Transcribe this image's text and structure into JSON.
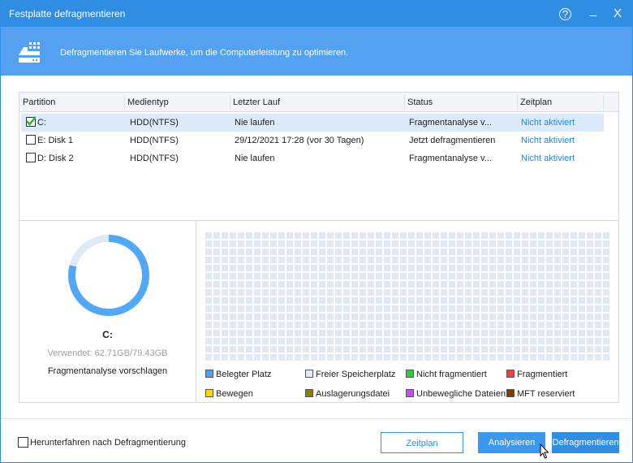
{
  "window": {
    "title": "Festplatte defragmentieren",
    "help_icon": "?",
    "minimize_icon": "_",
    "close_icon": "X"
  },
  "banner": {
    "text": "Defragmentieren Sie Laufwerke, um die Computerleistung zu optimieren."
  },
  "table": {
    "headers": [
      "Partition",
      "Medientyp",
      "Letzter Lauf",
      "Status",
      "Zeitplan"
    ],
    "rows": [
      {
        "checked": true,
        "partition": "C:",
        "media": "HDD(NTFS)",
        "last_run": "Nie laufen",
        "status": "Fragmentanalyse v...",
        "schedule": "Nicht aktiviert"
      },
      {
        "checked": false,
        "partition": "E:  Disk 1",
        "media": "HDD(NTFS)",
        "last_run": "29/12/2021 17:28 (vor 30 Tagen)",
        "status": "Jetzt defragmentieren",
        "schedule": "Nicht aktiviert"
      },
      {
        "checked": false,
        "partition": "D:  Disk 2",
        "media": "HDD(NTFS)",
        "last_run": "Nie laufen",
        "status": "Fragmentanalyse v...",
        "schedule": "Nicht aktiviert"
      }
    ]
  },
  "drive": {
    "name": "C:",
    "used_text": "Verwendet: 62.71GB/79.43GB",
    "used_fraction": 0.79,
    "suggestion": "Fragmentanalyse vorschlagen"
  },
  "legend": [
    {
      "label": "Belegter Platz",
      "color": "#4fa3f7"
    },
    {
      "label": "Freier Speicherplatz",
      "color": "#e3eaf3"
    },
    {
      "label": "Nicht fragmentiert",
      "color": "#2ecc40"
    },
    {
      "label": "Fragmentiert",
      "color": "#f04040"
    },
    {
      "label": "Bewegen",
      "color": "#ffd700"
    },
    {
      "label": "Auslagerungsdatei",
      "color": "#8a7d00"
    },
    {
      "label": "Unbewegliche Dateien",
      "color": "#c050f0"
    },
    {
      "label": "MFT reserviert",
      "color": "#7a4000"
    }
  ],
  "footer": {
    "shutdown_label": "Herunterfahren nach Defragmentierung",
    "schedule_btn": "Zeitplan",
    "analyze_btn": "Analysieren",
    "defrag_btn": "Defragmentieren"
  }
}
